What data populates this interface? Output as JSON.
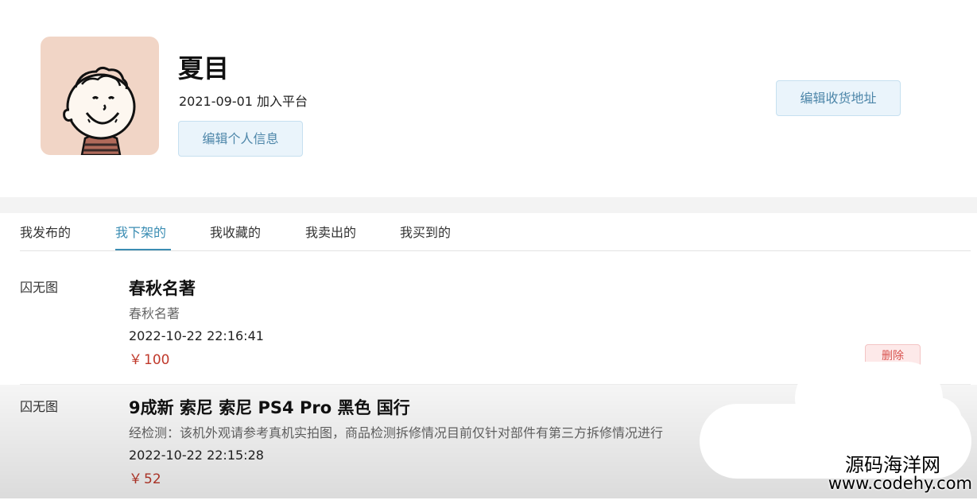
{
  "profile": {
    "username": "夏目",
    "join_date": "2021-09-01",
    "join_suffix": "加入平台",
    "edit_info_label": "编辑个人信息",
    "edit_address_label": "编辑收货地址",
    "avatar_icon": "cartoon-boy-avatar"
  },
  "tabs": [
    {
      "label": "我发布的",
      "active": false
    },
    {
      "label": "我下架的",
      "active": true
    },
    {
      "label": "我收藏的",
      "active": false
    },
    {
      "label": "我卖出的",
      "active": false
    },
    {
      "label": "我买到的",
      "active": false
    }
  ],
  "items": [
    {
      "image_placeholder": "囚无图",
      "title": "春秋名著",
      "description": "春秋名著",
      "time": "2022-10-22 22:16:41",
      "currency": "￥",
      "price": "100",
      "delete_label": "删除"
    },
    {
      "image_placeholder": "囚无图",
      "title": "9成新 索尼 索尼 PS4 Pro 黑色 国行",
      "description": "经检测：该机外观请参考真机实拍图，商品检测拆修情况目前仅针对部件有第三方拆修情况进行",
      "time": "2022-10-22 22:15:28",
      "currency": "￥",
      "price": "52"
    }
  ],
  "watermark": {
    "name": "源码海洋网",
    "url": "www.codehy.com"
  },
  "colors": {
    "accent": "#3b8db3",
    "price": "#c0392b",
    "avatar_bg": "#f1d5c6",
    "button_bg": "#eaf4fb"
  }
}
